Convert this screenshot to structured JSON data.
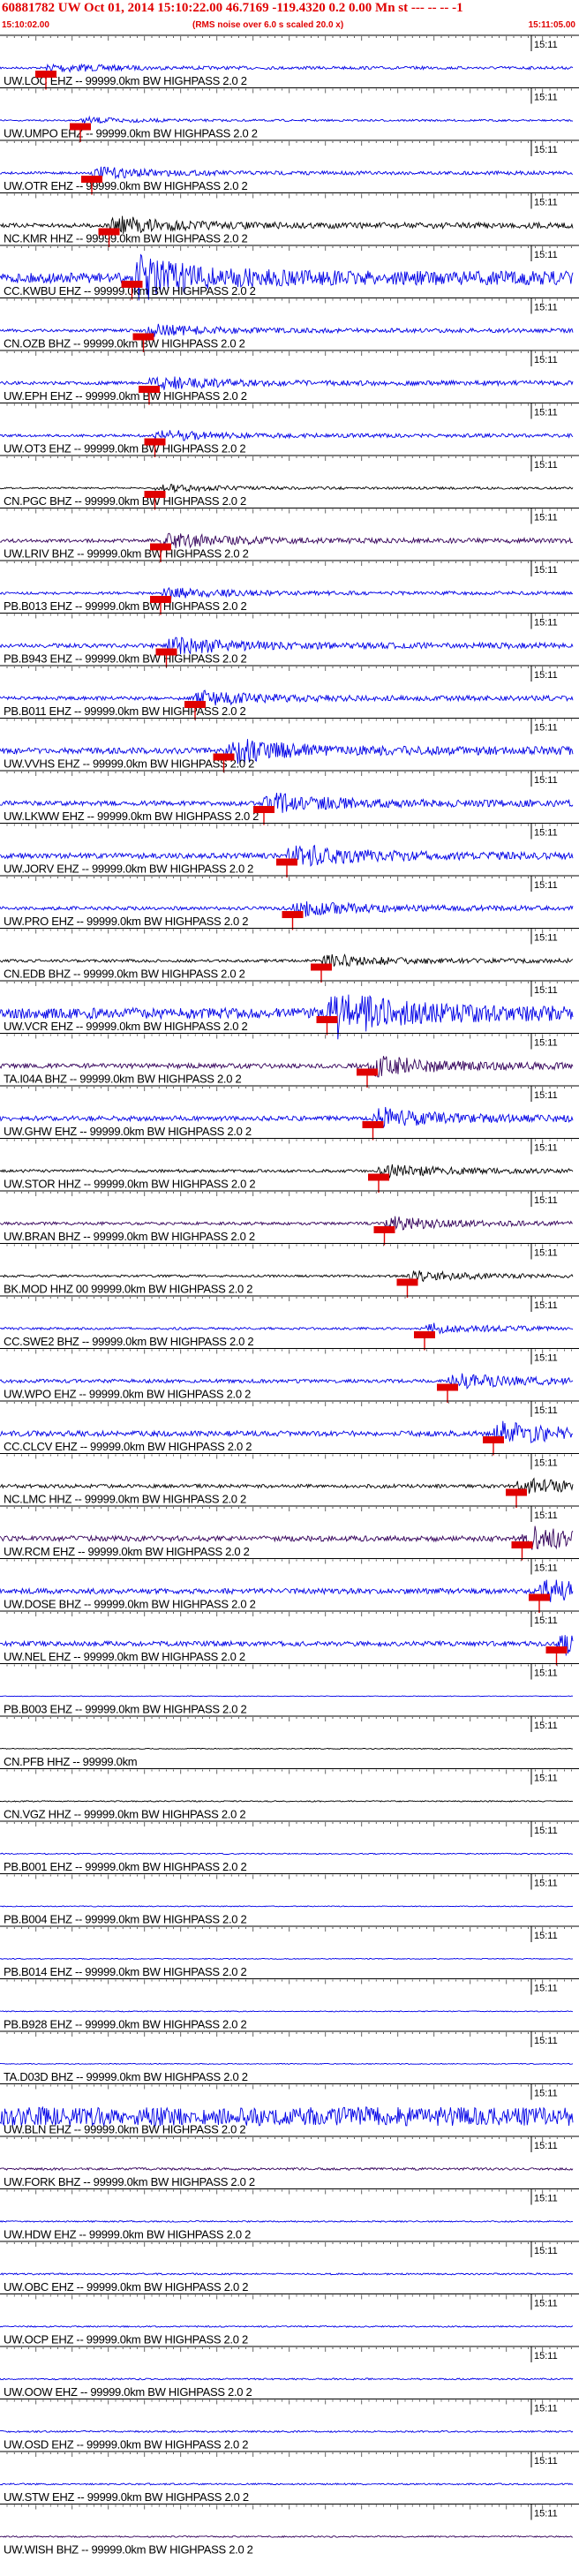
{
  "header": {
    "title": "60881782 UW Oct 01, 2014 15:10:22.00   46.7169 -119.4320  0.2 0.00 Mn st --- -- --  -1",
    "start_time": "15:10:02.00",
    "subtitle": "(RMS noise over 6.0 s scaled 20.0 x)",
    "end_time": "15:11:05.00"
  },
  "colors": {
    "trace_default": "#0000e6",
    "trace_dark": "#000000",
    "trace_purple": "#33005a",
    "pick": "#e00000",
    "time_text": "#000000"
  },
  "time_mark_label": "15:11",
  "channels": [
    {
      "label": "UW.LOC EHZ -- 99999.0km BW  HIGHPASS  2.0  2",
      "pick": 0.08,
      "amp": 0.18,
      "color": "blue"
    },
    {
      "label": "UW.UMPO EHZ -- 99999.0km BW  HIGHPASS  2.0  2",
      "pick": 0.14,
      "amp": 0.12,
      "color": "blue"
    },
    {
      "label": "UW.OTR EHZ -- 99999.0km BW  HIGHPASS  2.0  2",
      "pick": 0.16,
      "amp": 0.22,
      "color": "blue"
    },
    {
      "label": "NC.KMR HHZ -- 99999.0km BW  HIGHPASS  2.0  2",
      "pick": 0.19,
      "amp": 0.35,
      "color": "dark"
    },
    {
      "label": "CC.KWBU EHZ -- 99999.0km BW  HIGHPASS  2.0  2",
      "pick": 0.23,
      "amp": 0.85,
      "color": "blue"
    },
    {
      "label": "CN.OZB BHZ -- 99999.0km BW  HIGHPASS  2.0  2",
      "pick": 0.25,
      "amp": 0.25,
      "color": "blue"
    },
    {
      "label": "UW.EPH EHZ -- 99999.0km BW  HIGHPASS  2.0  2",
      "pick": 0.26,
      "amp": 0.28,
      "color": "blue"
    },
    {
      "label": "UW.OT3 EHZ -- 99999.0km BW  HIGHPASS  2.0  2",
      "pick": 0.27,
      "amp": 0.22,
      "color": "blue"
    },
    {
      "label": "CN.PGC BHZ -- 99999.0km BW  HIGHPASS  2.0  2",
      "pick": 0.27,
      "amp": 0.15,
      "color": "dark"
    },
    {
      "label": "UW.LRIV BHZ -- 99999.0km BW  HIGHPASS  2.0  2",
      "pick": 0.28,
      "amp": 0.3,
      "color": "purple"
    },
    {
      "label": "PB.B013 EHZ -- 99999.0km BW  HIGHPASS  2.0  2",
      "pick": 0.28,
      "amp": 0.22,
      "color": "blue"
    },
    {
      "label": "PB.B943 EHZ -- 99999.0km BW  HIGHPASS  2.0  2",
      "pick": 0.29,
      "amp": 0.35,
      "color": "blue"
    },
    {
      "label": "PB.B011 EHZ -- 99999.0km BW  HIGHPASS  2.0  2",
      "pick": 0.34,
      "amp": 0.3,
      "color": "blue"
    },
    {
      "label": "UW.VVHS EHZ -- 99999.0km BW  HIGHPASS  2.0  2",
      "pick": 0.39,
      "amp": 0.5,
      "color": "blue"
    },
    {
      "label": "UW.LKWW EHZ -- 99999.0km BW  HIGHPASS  2.0  2",
      "pick": 0.46,
      "amp": 0.4,
      "color": "blue"
    },
    {
      "label": "UW.JORV EHZ -- 99999.0km BW  HIGHPASS  2.0  2",
      "pick": 0.5,
      "amp": 0.45,
      "color": "blue"
    },
    {
      "label": "UW.PRO EHZ -- 99999.0km BW  HIGHPASS  2.0  2",
      "pick": 0.51,
      "amp": 0.3,
      "color": "blue"
    },
    {
      "label": "CN.EDB BHZ -- 99999.0km BW  HIGHPASS  2.0  2",
      "pick": 0.56,
      "amp": 0.25,
      "color": "dark"
    },
    {
      "label": "UW.VCR EHZ -- 99999.0km BW  HIGHPASS  2.0  2",
      "pick": 0.57,
      "amp": 0.9,
      "color": "blue"
    },
    {
      "label": "TA.I04A BHZ -- 99999.0km BW  HIGHPASS  2.0  2",
      "pick": 0.64,
      "amp": 0.4,
      "color": "purple"
    },
    {
      "label": "UW.GHW EHZ -- 99999.0km BW  HIGHPASS  2.0  2",
      "pick": 0.65,
      "amp": 0.4,
      "color": "blue"
    },
    {
      "label": "UW.STOR HHZ -- 99999.0km BW  HIGHPASS  2.0  2",
      "pick": 0.66,
      "amp": 0.25,
      "color": "dark"
    },
    {
      "label": "UW.BRAN BHZ -- 99999.0km BW  HIGHPASS  2.0  2",
      "pick": 0.67,
      "amp": 0.25,
      "color": "purple"
    },
    {
      "label": "BK.MOD HHZ 00 99999.0km BW  HIGHPASS  2.0  2",
      "pick": 0.71,
      "amp": 0.2,
      "color": "dark"
    },
    {
      "label": "CC.SWE2 BHZ -- 99999.0km BW  HIGHPASS  2.0  2",
      "pick": 0.74,
      "amp": 0.2,
      "color": "blue"
    },
    {
      "label": "UW.WPO EHZ -- 99999.0km BW  HIGHPASS  2.0  2",
      "pick": 0.78,
      "amp": 0.3,
      "color": "blue"
    },
    {
      "label": "CC.CLCV EHZ -- 99999.0km BW  HIGHPASS  2.0  2",
      "pick": 0.86,
      "amp": 0.45,
      "color": "blue"
    },
    {
      "label": "NC.LMC HHZ -- 99999.0km BW  HIGHPASS  2.0  2",
      "pick": 0.9,
      "amp": 0.3,
      "color": "dark"
    },
    {
      "label": "UW.RCM EHZ -- 99999.0km BW  HIGHPASS  2.0  2",
      "pick": 0.91,
      "amp": 0.45,
      "color": "purple"
    },
    {
      "label": "UW.DOSE BHZ -- 99999.0km BW  HIGHPASS  2.0  2",
      "pick": 0.94,
      "amp": 0.45,
      "color": "blue"
    },
    {
      "label": "UW.NEL EHZ -- 99999.0km BW  HIGHPASS  2.0  2",
      "pick": 0.97,
      "amp": 0.4,
      "color": "blue"
    },
    {
      "label": "PB.B003 EHZ -- 99999.0km BW  HIGHPASS  2.0  2",
      "pick": null,
      "amp": 0.06,
      "color": "blue"
    },
    {
      "label": "CN.PFB HHZ -- 99999.0km",
      "pick": null,
      "amp": 0.08,
      "color": "dark"
    },
    {
      "label": "CN.VGZ HHZ -- 99999.0km BW  HIGHPASS  2.0  2",
      "pick": null,
      "amp": 0.1,
      "color": "dark"
    },
    {
      "label": "PB.B001 EHZ -- 99999.0km BW  HIGHPASS  2.0  2",
      "pick": null,
      "amp": 0.1,
      "color": "blue"
    },
    {
      "label": "PB.B004 EHZ -- 99999.0km BW  HIGHPASS  2.0  2",
      "pick": null,
      "amp": 0.08,
      "color": "blue"
    },
    {
      "label": "PB.B014 EHZ -- 99999.0km BW  HIGHPASS  2.0  2",
      "pick": null,
      "amp": 0.08,
      "color": "blue"
    },
    {
      "label": "PB.B928 EHZ -- 99999.0km BW  HIGHPASS  2.0  2",
      "pick": null,
      "amp": 0.08,
      "color": "blue"
    },
    {
      "label": "TA.D03D BHZ -- 99999.0km BW  HIGHPASS  2.0  2",
      "pick": null,
      "amp": 0.08,
      "color": "blue"
    },
    {
      "label": "UW.BLN EHZ -- 99999.0km BW  HIGHPASS  2.0  2",
      "pick": null,
      "amp": 1.6,
      "color": "blue"
    },
    {
      "label": "UW.FORK BHZ -- 99999.0km BW  HIGHPASS  2.0  2",
      "pick": null,
      "amp": 0.2,
      "color": "purple"
    },
    {
      "label": "UW.HDW EHZ -- 99999.0km BW  HIGHPASS  2.0  2",
      "pick": null,
      "amp": 0.12,
      "color": "blue"
    },
    {
      "label": "UW.OBC EHZ -- 99999.0km BW  HIGHPASS  2.0  2",
      "pick": null,
      "amp": 0.14,
      "color": "blue"
    },
    {
      "label": "UW.OCP EHZ -- 99999.0km BW  HIGHPASS  2.0  2",
      "pick": null,
      "amp": 0.12,
      "color": "blue"
    },
    {
      "label": "UW.OOW EHZ -- 99999.0km BW  HIGHPASS  2.0  2",
      "pick": null,
      "amp": 0.14,
      "color": "blue"
    },
    {
      "label": "UW.OSD EHZ -- 99999.0km BW  HIGHPASS  2.0  2",
      "pick": null,
      "amp": 0.14,
      "color": "blue"
    },
    {
      "label": "UW.STW EHZ -- 99999.0km BW  HIGHPASS  2.0  2",
      "pick": null,
      "amp": 0.14,
      "color": "blue"
    },
    {
      "label": "UW.WISH BHZ -- 99999.0km BW  HIGHPASS  2.0  2",
      "pick": null,
      "amp": 0.12,
      "color": "purple"
    }
  ]
}
